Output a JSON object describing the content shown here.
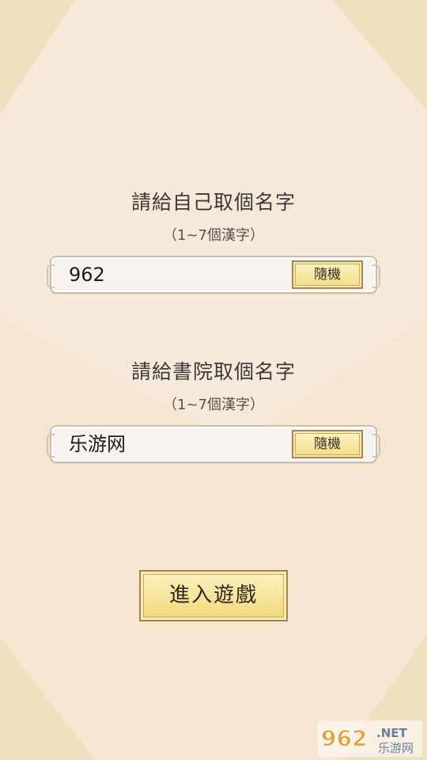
{
  "form": {
    "player_name": {
      "prompt": "請給自己取個名字",
      "hint": "（1~7個漢字）",
      "value": "962",
      "random_label": "隨機"
    },
    "academy_name": {
      "prompt": "請給書院取個名字",
      "hint": "（1~7個漢字）",
      "value": "乐游网",
      "random_label": "隨機"
    },
    "enter_label": "進入遊戲"
  },
  "watermark": {
    "brand": "962",
    "suffix": ".NET",
    "tagline": "乐游网"
  },
  "colors": {
    "background": "#f6e8d6",
    "button_gold": "#f4dc86",
    "button_border": "#a4864f",
    "text": "#3d3936"
  }
}
